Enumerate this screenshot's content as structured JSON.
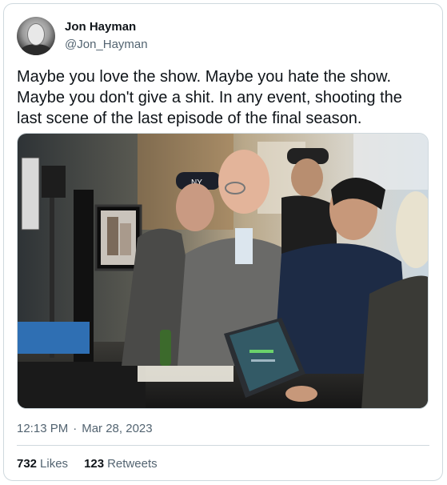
{
  "author": {
    "name": "Jon Hayman",
    "handle": "@Jon_Hayman"
  },
  "tweet": {
    "text": "Maybe you love the show. Maybe you hate the show. Maybe you don't give a shit. In any event, shooting the last scene of the last episode of the final season."
  },
  "media": {
    "icon": "photo-icon",
    "cap_logo": "NY"
  },
  "meta": {
    "time": "12:13 PM",
    "separator": "·",
    "date": "Mar 28, 2023"
  },
  "stats": {
    "likes_count": "732",
    "likes_label": "Likes",
    "retweets_count": "123",
    "retweets_label": "Retweets"
  },
  "colors": {
    "text": "#0f1419",
    "secondary": "#536471",
    "border": "#cfd9de"
  }
}
